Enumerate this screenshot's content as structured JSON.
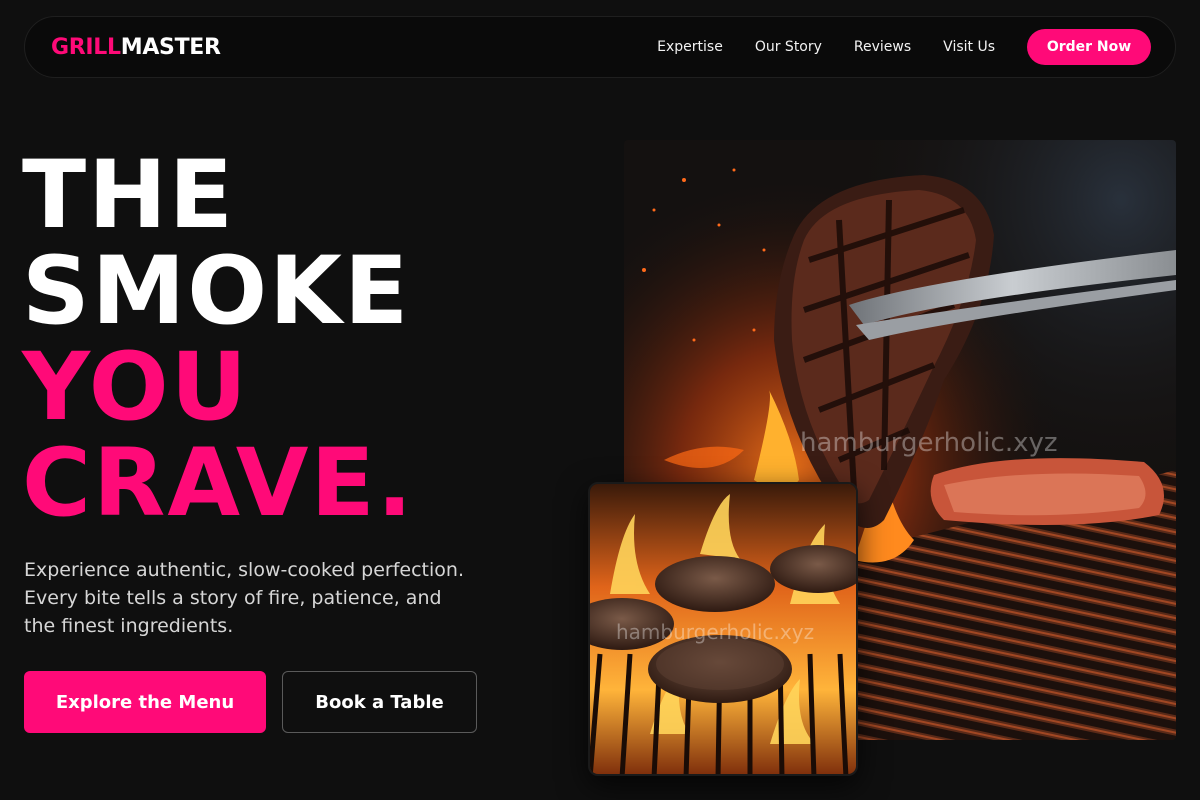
{
  "brand": {
    "logo_accent": "GRILL",
    "logo_rest": "MASTER"
  },
  "nav": {
    "links": [
      "Expertise",
      "Our Story",
      "Reviews",
      "Visit Us"
    ],
    "cta": "Order Now"
  },
  "hero": {
    "headline_white": [
      "THE",
      "SMOKE"
    ],
    "headline_pink": [
      "YOU",
      "CRAVE."
    ],
    "subtitle": "Experience authentic, slow-cooked perfection. Every bite tells a story of fire, patience, and the finest ingredients.",
    "primary_cta": "Explore the Menu",
    "secondary_cta": "Book a Table"
  },
  "images": {
    "main": {
      "subject": "steak held by tongs over a flaming grill",
      "watermark": "hamburgerholic.xyz"
    },
    "inset": {
      "subject": "burger patties on a flaming grill grate",
      "watermark": "hamburgerholic.xyz"
    }
  },
  "colors": {
    "accent": "#ff0a78",
    "background": "#0f0f0f",
    "nav_bg": "#0a0a0a"
  }
}
